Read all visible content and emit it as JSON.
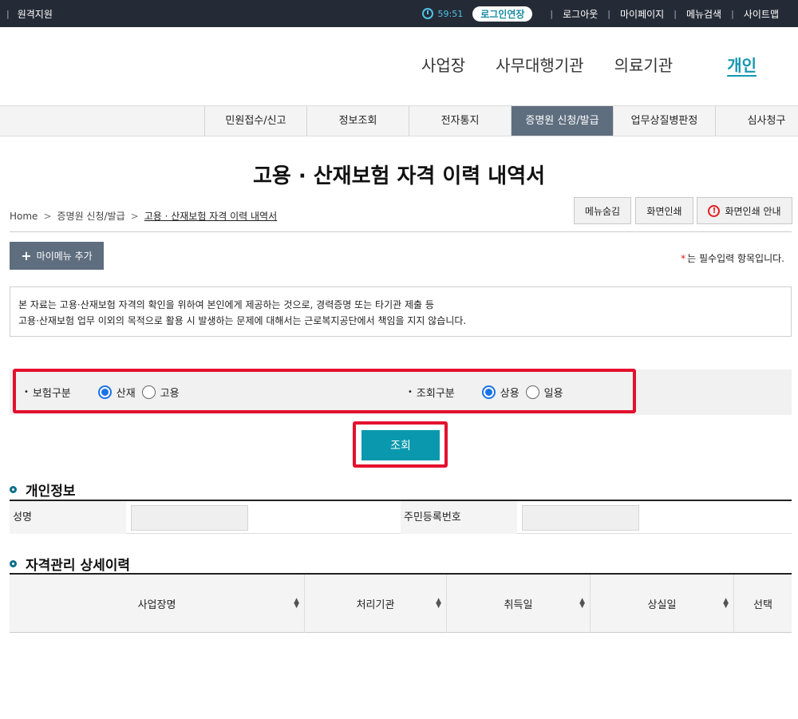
{
  "topbar": {
    "remote_support": "원격지원",
    "timer": "59:51",
    "extend_login": "로그인연장",
    "links": [
      "로그아웃",
      "마이페이지",
      "메뉴검색",
      "사이트맵"
    ]
  },
  "gnb": {
    "items": [
      "사업장",
      "사무대행기관",
      "의료기관",
      "개인"
    ],
    "active_index": 3
  },
  "subnav": {
    "items": [
      "민원접수/신고",
      "정보조회",
      "전자통지",
      "증명원 신청/발급",
      "업무상질병판정",
      "심사청구"
    ],
    "active_index": 3
  },
  "page_title": "고용 · 산재보험 자격 이력 내역서",
  "breadcrumb": {
    "home": "Home",
    "level1": "증명원 신청/발급",
    "current": "고용 · 산재보험 자격 이력 내역서"
  },
  "tools": {
    "hide_menu": "메뉴숨김",
    "print": "화면인쇄",
    "print_guide": "화면인쇄 안내"
  },
  "mymenu_add": "마이메뉴 추가",
  "required_note": {
    "star": "*",
    "text": "는 필수입력 항목입니다."
  },
  "notice": {
    "line1": "본 자료는 고용·산재보험 자격의 확인을 위하여 본인에게 제공하는 것으로, 경력증명 또는 타기관 제출 등",
    "line2": "고용·산재보험 업무 이외의 목적으로 활용 시 발생하는 문제에 대해서는 근로복지공단에서 책임을 지지 않습니다."
  },
  "search": {
    "insurance_type": {
      "label": "보험구분",
      "options": [
        "산재",
        "고용"
      ],
      "selected": "산재"
    },
    "query_type": {
      "label": "조회구분",
      "options": [
        "상용",
        "일용"
      ],
      "selected": "상용"
    },
    "submit": "조회"
  },
  "personal_info": {
    "title": "개인정보",
    "name_label": "성명",
    "name_value": "",
    "rrn_label": "주민등록번호",
    "rrn_value": ""
  },
  "history": {
    "title": "자격관리 상세이력",
    "columns": [
      "사업장명",
      "처리기관",
      "취득일",
      "상실일",
      "선택"
    ]
  },
  "colors": {
    "topbar_bg": "#252b36",
    "accent": "#0a98ae",
    "active_tab": "#5e6e7f",
    "highlight_red": "#e4102e",
    "radio_blue": "#1a73e8"
  }
}
